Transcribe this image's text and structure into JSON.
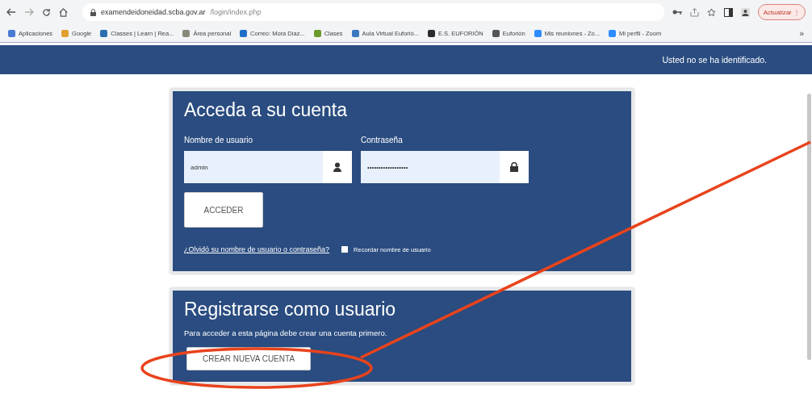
{
  "browser": {
    "url_host": "examendeidoneidad.scba.gov.ar",
    "url_path": "/login/index.php",
    "update_button": "Actualizar",
    "menu": "⋮",
    "bookmarks": [
      {
        "label": "Aplicaciones",
        "color": "#4a7bd6"
      },
      {
        "label": "Google",
        "color": "#e0a030"
      },
      {
        "label": "Classes | Learn | Rea...",
        "color": "#2a6fb0"
      },
      {
        "label": "Área personal",
        "color": "#8a8a7a"
      },
      {
        "label": "Correo: Mora Diaz...",
        "color": "#1e6fc8"
      },
      {
        "label": "Clases",
        "color": "#6a9a2a"
      },
      {
        "label": "Aula Virtual Euforió...",
        "color": "#3a78c0"
      },
      {
        "label": "E.S. EUFORIÓN",
        "color": "#2a2a2a"
      },
      {
        "label": "Euforión",
        "color": "#555555"
      },
      {
        "label": "Mis reuniones - Zo...",
        "color": "#2d8cff"
      },
      {
        "label": "Mi perfil - Zoom",
        "color": "#2d8cff"
      }
    ],
    "more": "»"
  },
  "header": {
    "status": "Usted no se ha identificado."
  },
  "login": {
    "title": "Acceda a su cuenta",
    "username_label": "Nombre de usuario",
    "username_value": "admin",
    "password_label": "Contraseña",
    "password_value": "••••••••••••••••••",
    "submit": "ACCEDER",
    "forgot_link": "¿Olvidó su nombre de usuario o contraseña?",
    "remember": {
      "label": "Recordar nombre de usuario",
      "checked": false
    }
  },
  "signup": {
    "title": "Registrarse como usuario",
    "text": "Para acceder a esta página debe crear una cuenta primero.",
    "button": "CREAR NUEVA CUENTA"
  }
}
